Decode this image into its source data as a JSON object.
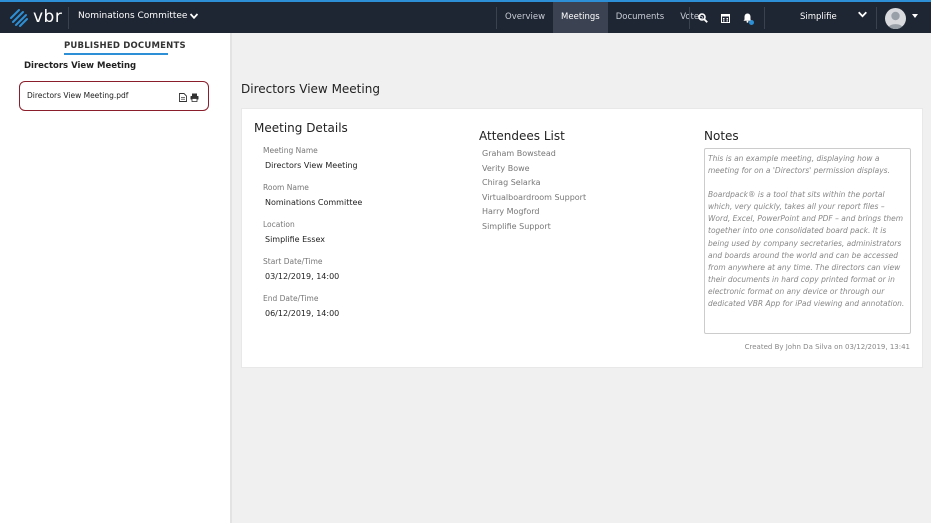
{
  "header": {
    "logo_text": "vbr",
    "committee": "Nominations Committee",
    "nav": [
      {
        "label": "Overview",
        "active": false
      },
      {
        "label": "Meetings",
        "active": true
      },
      {
        "label": "Documents",
        "active": false
      },
      {
        "label": "Votes",
        "active": false
      }
    ],
    "icons": [
      "search-icon",
      "calendar-icon",
      "bell-icon"
    ],
    "organisation": "Simplifie",
    "accent_color": "#2d8fd5",
    "bar_color": "#1f2633"
  },
  "sidebar": {
    "title": "PUBLISHED DOCUMENTS",
    "meeting_name": "Directors View Meeting",
    "documents": [
      {
        "name": "Directors View Meeting.pdf",
        "icons": [
          "document-icon",
          "print-icon"
        ]
      }
    ]
  },
  "main": {
    "page_title": "Directors View Meeting",
    "details": {
      "title": "Meeting Details",
      "fields": [
        {
          "label": "Meeting Name",
          "value": "Directors View Meeting"
        },
        {
          "label": "Room Name",
          "value": "Nominations Committee"
        },
        {
          "label": "Location",
          "value": "Simplifie Essex"
        },
        {
          "label": "Start Date/Time",
          "value": "03/12/2019, 14:00"
        },
        {
          "label": "End Date/Time",
          "value": "06/12/2019, 14:00"
        }
      ]
    },
    "attendees": {
      "title": "Attendees List",
      "list": [
        "Graham Bowstead",
        "Verity Bowe",
        "Chirag Selarka",
        "Virtualboardroom Support",
        "Harry Mogford",
        "Simplifie Support"
      ]
    },
    "notes": {
      "title": "Notes",
      "paragraphs": [
        "This is an example meeting, displaying how a meeting for on a 'Directors' permission displays.",
        "Boardpack® is a tool that sits within the portal which, very quickly, takes all your report files – Word, Excel, PowerPoint and PDF – and brings them together into one consolidated board pack. It is being used by company secretaries, administrators and boards around the world and can be accessed from anywhere at any time. The directors can view their documents in hard copy printed format or in electronic format on any device or through our dedicated VBR App for iPad viewing and annotation."
      ]
    },
    "created_by": "Created By John Da Silva on 03/12/2019, 13:41"
  }
}
